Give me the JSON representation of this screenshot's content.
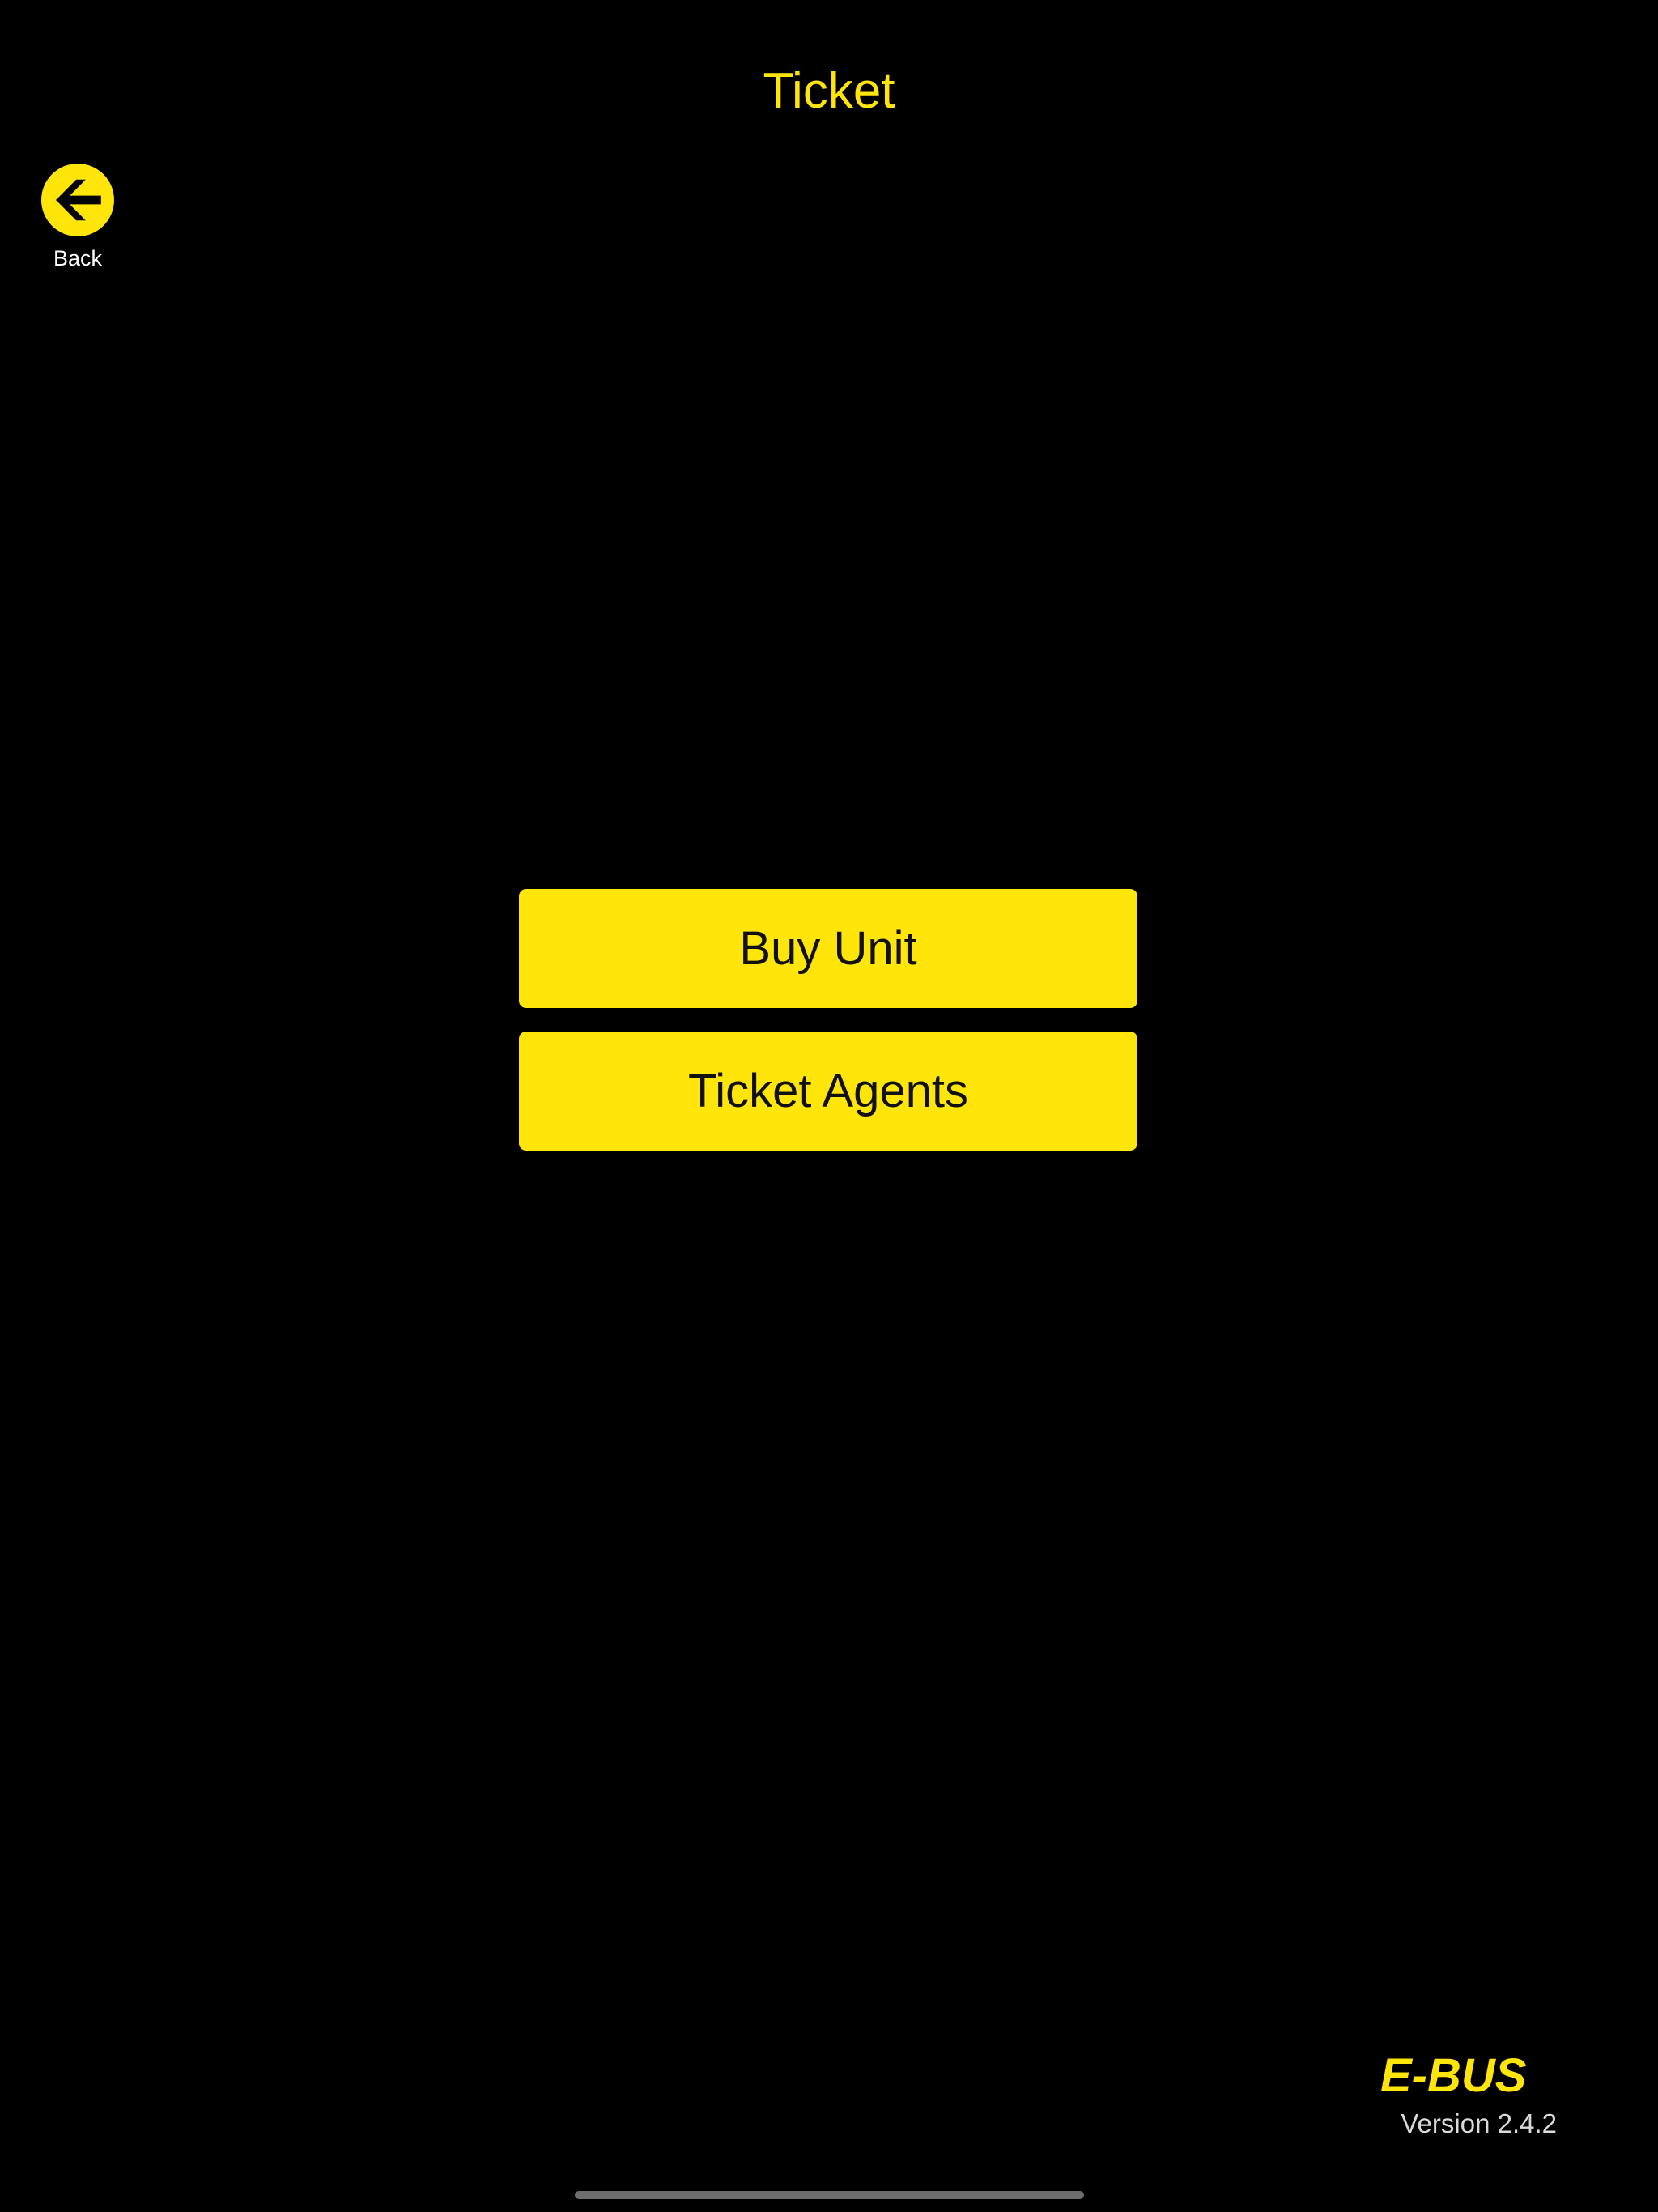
{
  "header": {
    "title": "Ticket"
  },
  "nav": {
    "back_label": "Back",
    "back_icon": "arrow-left-circle-icon"
  },
  "menu": {
    "buy_unit_label": "Buy Unit",
    "ticket_agents_label": "Ticket Agents"
  },
  "footer": {
    "logo_text": "E-BUS",
    "version": "Version 2.4.2"
  },
  "colors": {
    "accent": "#FFE50A",
    "background": "#000000",
    "button_text": "#111111",
    "secondary_text": "#DADADA"
  }
}
